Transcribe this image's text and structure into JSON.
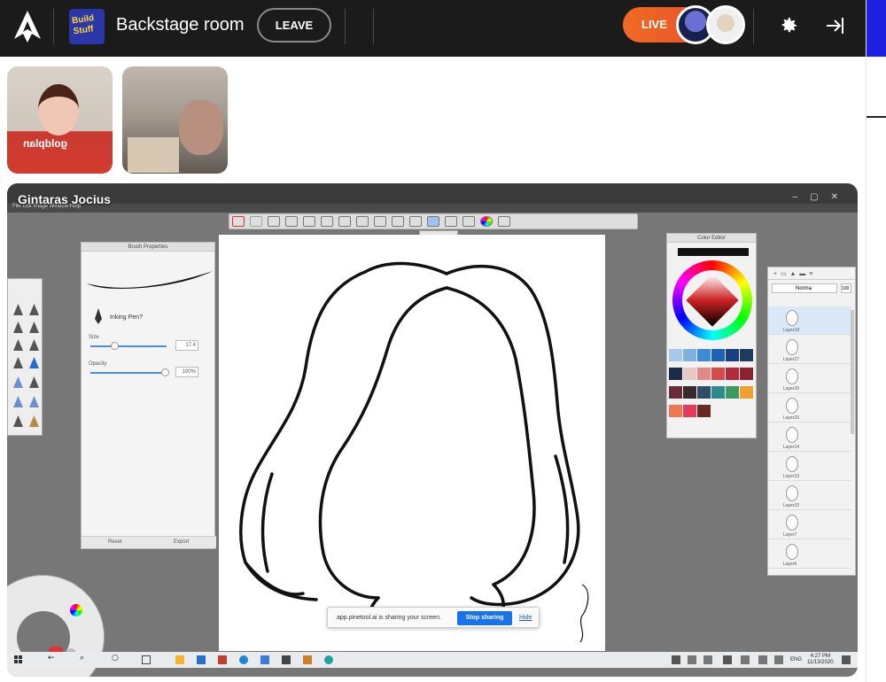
{
  "header": {
    "event_thumb_text": "Build Stuff",
    "room_title": "Backstage room",
    "leave_label": "LEAVE",
    "live_label": "LIVE"
  },
  "screen_share": {
    "presenter_name": "Gintaras Jocius",
    "menu": "File   Edit   Image   Window   Help",
    "layer_tab_label": "4"
  },
  "brush_panel": {
    "title": "Brush Properties",
    "brush_name": "Inking Pen?",
    "size_label": "Size",
    "size_value": "17.4",
    "opacity_label": "Opacity",
    "opacity_value": "100%",
    "reset_label": "Reset",
    "export_label": "Export"
  },
  "color_panel": {
    "title": "Color Editor",
    "swatches": [
      "#a9c7e6",
      "#7fb0e0",
      "#3d8ad6",
      "#1f5fb4",
      "#183f82",
      "#203a5c",
      "#1b2a4a",
      "#e9c7c3",
      "#e38888",
      "#d44b4b",
      "#b42a3a",
      "#8e2030",
      "#6a2b3b",
      "#3a2a2a",
      "#2f4d6a",
      "#2f8b8b",
      "#3a9a5f",
      "#f0a030",
      "#f07850",
      "#e63a5a",
      "#6a2a20"
    ]
  },
  "layers_panel": {
    "blend_mode": "Norma",
    "opacity": "100",
    "layers": [
      "Layer18",
      "Layer17",
      "Layer16",
      "Layer15",
      "Layer14",
      "Layer13",
      "Layer10",
      "Layer7",
      "Layer6"
    ]
  },
  "share_bar": {
    "message": "app.pinetool.ai is sharing your screen.",
    "stop_label": "Stop sharing",
    "hide_label": "Hide"
  },
  "taskbar": {
    "lang": "ENG",
    "time": "4:27 PM",
    "date": "11/13/2020"
  }
}
